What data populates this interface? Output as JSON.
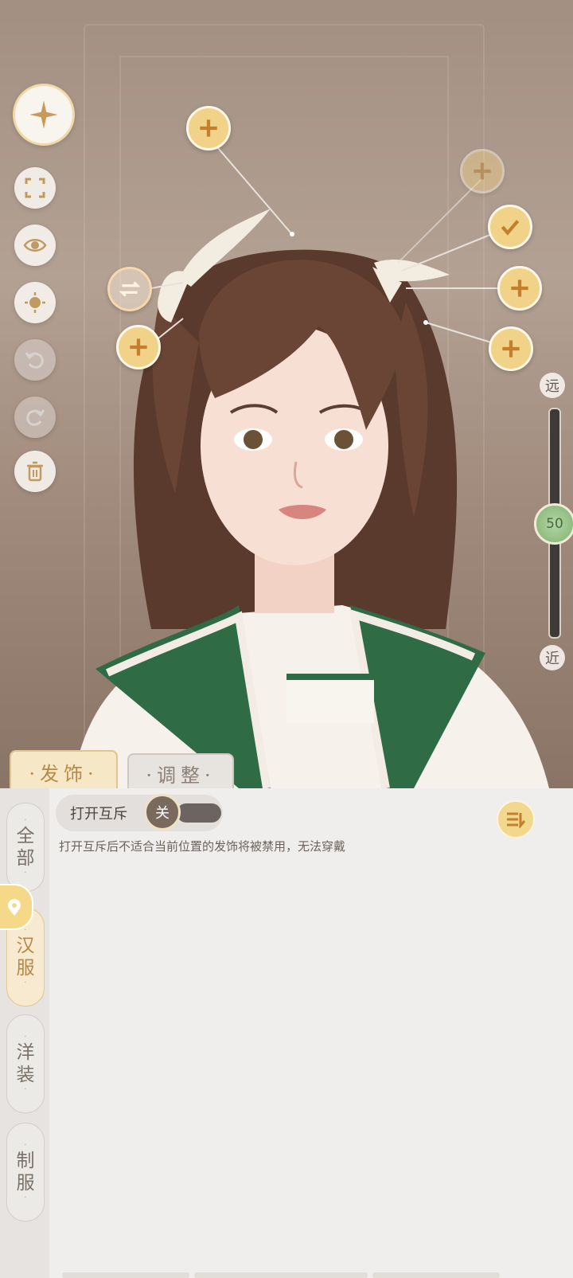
{
  "tools": {
    "home_icon": "compass-star-icon",
    "fullscreen_icon": "fullscreen-icon",
    "view_icon": "eye-icon",
    "light_icon": "light-icon",
    "undo_icon": "undo-icon",
    "redo_icon": "redo-icon",
    "delete_icon": "trash-icon"
  },
  "zoom": {
    "far_label": "远",
    "near_label": "近",
    "value": "50",
    "level_fraction": 0.5
  },
  "tabs": {
    "accessory": "·发饰·",
    "adjust": "·调整·"
  },
  "sidebar": {
    "items": [
      {
        "label_top": "全",
        "label_bottom": "部"
      },
      {
        "label_top": "汉",
        "label_bottom": "服"
      },
      {
        "label_top": "洋",
        "label_bottom": "装"
      },
      {
        "label_top": "制",
        "label_bottom": "服"
      }
    ]
  },
  "toggle": {
    "label": "打开互斥",
    "state": "关"
  },
  "hint": "打开互斥后不适合当前位置的发饰将被禁用，无法穿戴",
  "colors": {
    "accent_gold": "#f1d289",
    "active_tab": "#b4884a",
    "zoom_green": "#8fbd80"
  }
}
